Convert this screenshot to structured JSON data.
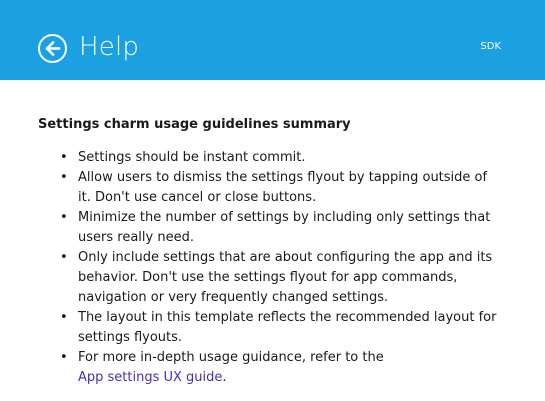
{
  "header": {
    "title": "Help",
    "badge": "SDK",
    "back_icon": "back-arrow-circle-icon",
    "background_color": "#1ba1e2"
  },
  "main": {
    "heading": "Settings charm usage guidelines summary",
    "items": [
      "Settings should be instant commit.",
      "Allow users to dismiss the settings flyout by tapping outside of it. Don't use cancel or close buttons.",
      "Minimize the number of settings by including only settings that users really need.",
      "Only include settings that are about configuring the app and its behavior. Don't use the settings flyout for app commands, navigation or very frequently changed settings.",
      "The layout in this template reflects the recommended layout for settings flyouts."
    ],
    "last_item_text": "For more in-depth usage guidance, refer to the",
    "link_text": "App settings UX guide",
    "link_suffix": ".",
    "link_color": "#4b2dbf"
  }
}
